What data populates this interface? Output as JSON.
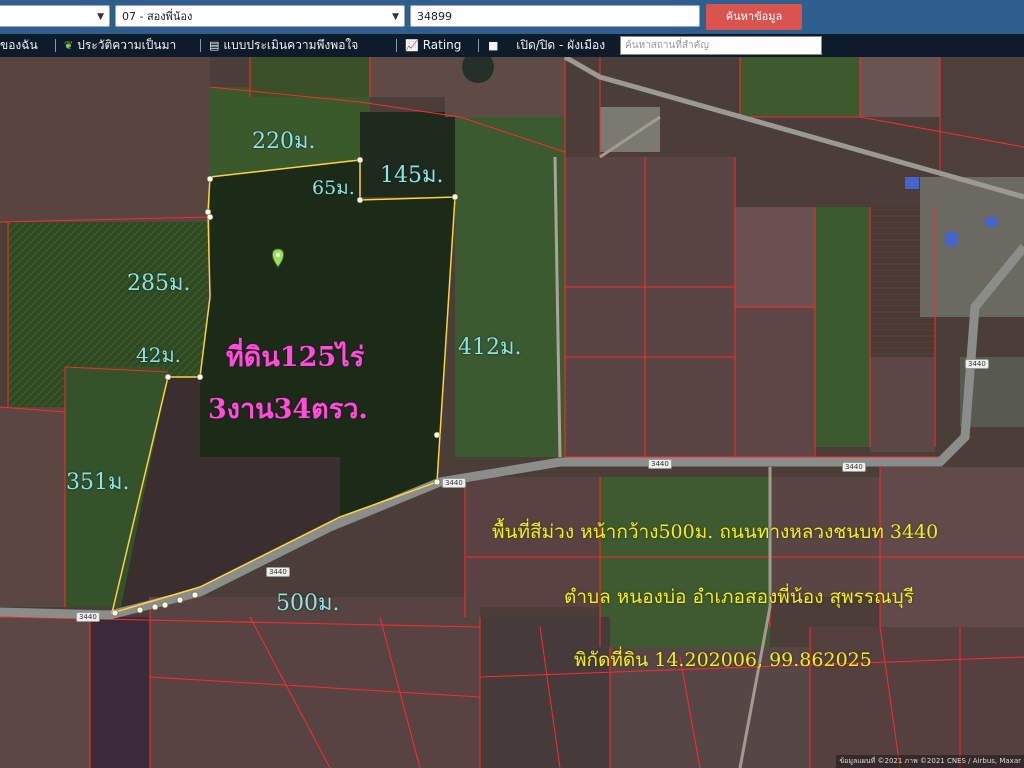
{
  "topbar": {
    "province_value": "",
    "district_value": "07 - สองพี่น้อง",
    "parcel_value": "34899",
    "search_button": "ค้นหาข้อมูล"
  },
  "menubar": {
    "item1": "ของฉัน",
    "item2": "ประวัติความเป็นมา",
    "item3": "แบบประเมินความพึงพอใจ",
    "item4": "Rating",
    "item5": "เปิด/ปิด - ผังเมือง",
    "place_search_placeholder": "ค้นหาสถานที่สำคัญ"
  },
  "map": {
    "dimensions": {
      "d220": "220ม.",
      "d65": "65ม.",
      "d145": "145ม.",
      "d285": "285ม.",
      "d42": "42ม.",
      "d412": "412ม.",
      "d351": "351ม.",
      "d500": "500ม."
    },
    "area_line1": "ที่ดิน125ไร่",
    "area_line2": "3งาน34ตรว.",
    "info_line1": "พื้นที่สีม่วง หน้ากว้าง500ม. ถนนทางหลวงชนบท 3440",
    "info_line2": "ตำบล หนองบ่อ อำเภอสองพี่น้อง สุพรรณบุรี",
    "info_line3": "พิกัดที่ดิน 14.202006, 99.862025",
    "road_number": "3440",
    "attribution": "ข้อมูลแผนที่ ©2021 ภาพ ©2021 CNES / Airbus, Maxar"
  },
  "colors": {
    "topbar": "#2f5f8f",
    "menubar": "#0d1b2a",
    "search_button": "#d9534f",
    "parcel_outline": "#ff2a2a",
    "selected_outline": "#ffd23f",
    "dimension_text": "#8fe3e6",
    "area_text": "#ff4fd8",
    "info_text": "#f4ec2f"
  }
}
